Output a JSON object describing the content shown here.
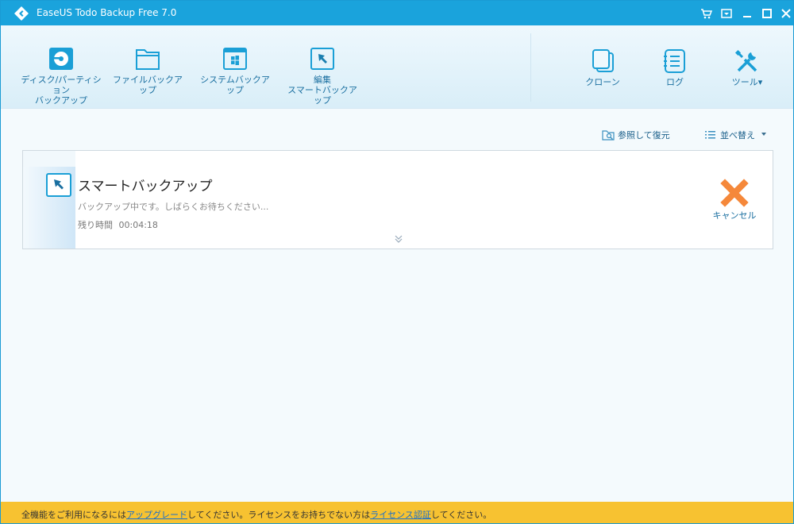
{
  "window": {
    "title": "EaseUS Todo Backup Free 7.0"
  },
  "toolbar": {
    "left_tools": [
      {
        "label": "ディスク/パーティション\nバックアップ",
        "icon": "disk-icon"
      },
      {
        "label": "ファイルバックアップ",
        "icon": "folder-icon"
      },
      {
        "label": "システムバックアップ",
        "icon": "windows-icon"
      },
      {
        "label": "編集\nスマートバックアップ",
        "icon": "smart-backup-icon"
      }
    ],
    "right_tools": [
      {
        "label": "クローン",
        "icon": "clone-icon"
      },
      {
        "label": "ログ",
        "icon": "log-icon"
      },
      {
        "label": "ツール▾",
        "icon": "tools-icon"
      }
    ]
  },
  "subbar": {
    "browse_restore": "参照して復元",
    "sort": "並べ替え"
  },
  "task": {
    "title": "スマートバックアップ",
    "status": "バックアップ中です。しばらくお待ちください...",
    "remaining_label": "残り時間",
    "remaining_time": "00:04:18",
    "cancel_label": "キャンセル"
  },
  "footer": {
    "text_1": "全機能をご利用になるには",
    "link_upgrade": "アップグレード",
    "text_2": "してください。ライセンスをお持ちでない方は",
    "link_license": "ライセンス認証",
    "text_3": "してください。"
  },
  "colors": {
    "titlebar": "#1aa3dc",
    "accent": "#1a6fa0",
    "cancel": "#f5883a",
    "footer": "#f7c231"
  }
}
